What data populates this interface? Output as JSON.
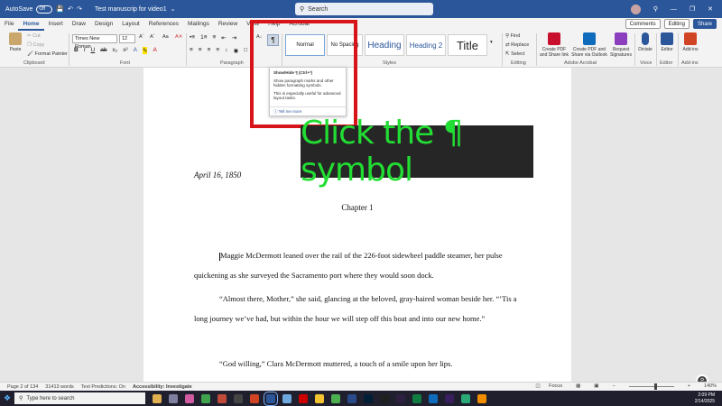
{
  "titlebar": {
    "autosave": "AutoSave",
    "autosave_state": "Off",
    "doc_title": "Test manuscrip for video1",
    "search_placeholder": "Search"
  },
  "menu": {
    "items": [
      "File",
      "Home",
      "Insert",
      "Draw",
      "Design",
      "Layout",
      "References",
      "Mailings",
      "Review",
      "View",
      "Help",
      "Acrobat"
    ],
    "active": "Home",
    "comments": "Comments",
    "editing": "Editing",
    "share": "Share"
  },
  "ribbon": {
    "paste": "Paste",
    "cut": "Cut",
    "copy": "Copy",
    "format_painter": "Format Painter",
    "font_name": "Times New Roman",
    "font_size": "12",
    "styles": [
      "Normal",
      "No Spacing",
      "Heading",
      "Heading 2",
      "Title"
    ],
    "find": "Find",
    "replace": "Replace",
    "select": "Select",
    "create_pdf_share": "Create PDF and Share link",
    "create_pdf_outlook": "Create PDF and Share via Outlook",
    "request_signatures": "Request Signatures",
    "dictate": "Dictate",
    "editor": "Editor",
    "addins": "Add-ins",
    "group_labels": {
      "clipboard": "Clipboard",
      "font": "Font",
      "paragraph": "Paragraph",
      "styles": "Styles",
      "editing": "Editing",
      "adobe": "Adobe Acrobat",
      "voice": "Voice",
      "editor": "Editor",
      "addins": "Add-ins"
    }
  },
  "tooltip": {
    "title": "Show/Hide ¶ (Ctrl+*)",
    "line1": "Show paragraph marks and other hidden formatting symbols.",
    "line2": "This is especially useful for advanced layout tasks.",
    "tell_more": "Tell me more"
  },
  "banner": {
    "text": "Click the ¶ symbol"
  },
  "document": {
    "date": "April 16, 1850",
    "chapter": "Chapter 1",
    "p1": "Maggie McDermott leaned over the rail of the 226-foot sidewheel paddle steamer, her pulse quickening as she surveyed the Sacramento port where they would soon dock.",
    "p2": "“Almost there, Mother,” she said, glancing at the beloved, gray-haired woman beside her. “’Tis a long journey we’ve had, but within the hour we will step off this boat and into our new home.”",
    "p3": "“God willing,” Clara McDermott muttered, a touch of a smile upon her lips."
  },
  "statusbar": {
    "page": "Page 2 of 134",
    "words": "31413 words",
    "predictions": "Text Predictions: On",
    "accessibility": "Accessibility: Investigate",
    "focus": "Focus",
    "zoom": "140%"
  },
  "taskbar": {
    "search_placeholder": "Type here to search",
    "time": "2:09 PM",
    "date": "2/14/2025"
  },
  "colors": {
    "word_blue": "#2b579a",
    "highlight_red": "#d8141b",
    "banner_green": "#22dd33"
  }
}
